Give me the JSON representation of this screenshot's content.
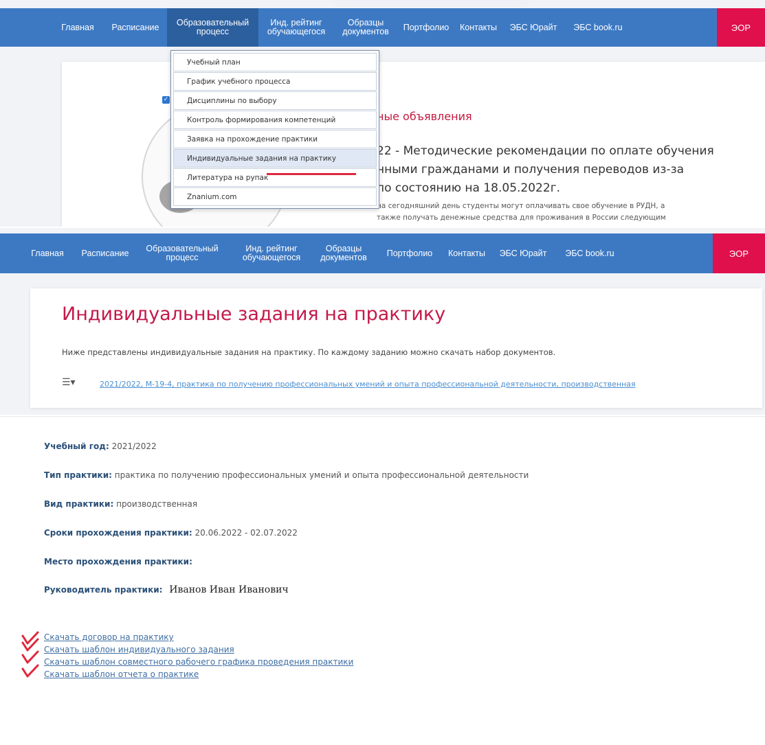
{
  "nav": {
    "items": [
      {
        "label": "Главная"
      },
      {
        "label": "Расписание"
      },
      {
        "label": "Образовательный\nпроцесс"
      },
      {
        "label": "Инд. рейтинг\nобучающегося"
      },
      {
        "label": "Образцы\nдокументов"
      },
      {
        "label": "Портфолио"
      },
      {
        "label": "Контакты"
      },
      {
        "label": "ЭБС Юрайт"
      },
      {
        "label": "ЭБС book.ru"
      }
    ],
    "zor_label": "ЭОР"
  },
  "dropdown": {
    "items": [
      {
        "label": "Учебный план"
      },
      {
        "label": "График учебного процесса"
      },
      {
        "label": "Дисциплины по выбору"
      },
      {
        "label": "Контроль формирования компетенций"
      },
      {
        "label": "Заявка на прохождение практики"
      },
      {
        "label": "Индивидуальные задания на практику"
      },
      {
        "label": "Литература на рупак"
      },
      {
        "label": "Znanium.com"
      }
    ]
  },
  "news": {
    "title": "ные объявления",
    "lines": [
      "22 - Методические рекомендации по оплате обучения",
      "нными гражданами и получения переводов из-за",
      "по состоянию на 18.05.2022г."
    ],
    "body_lines": [
      "на сегодняшний день студенты могут оплачивать свое обучение в РУДН, а",
      "также получать денежные средства для проживания в России следующим"
    ]
  },
  "page": {
    "title": "Индивидуальные задания на практику",
    "intro": "Ниже представлены индивидуальные задания на практику. По каждому заданию можно скачать набор документов.",
    "practice_link": "2021/2022, М-19-4, практика по получению профессиональных умений и опыта профессиональной деятельности, производственная"
  },
  "details": {
    "year_label": "Учебный год:",
    "year_value": "2021/2022",
    "type_label": "Тип практики:",
    "type_value": "практика по получению профессиональных умений и опыта профессиональной деятельности",
    "kind_label": "Вид практики:",
    "kind_value": "производственная",
    "dates_label": "Сроки прохождения практики:",
    "dates_value": "20.06.2022 - 02.07.2022",
    "place_label": "Место прохождения практики:",
    "supervisor_label": "Руководитель практики:",
    "supervisor_value": "Иванов Иван Иванович"
  },
  "downloads": [
    {
      "label": "Скачать договор на практику"
    },
    {
      "label": "Скачать шаблон индивидуального задания"
    },
    {
      "label": "Скачать шаблон совместного рабочего графика проведения практики"
    },
    {
      "label": "Скачать шаблон отчета о практике"
    }
  ],
  "colors": {
    "navbar": "#3d79c3",
    "zor": "#e0104c",
    "title": "#c41a4a",
    "annotation": "#e0273c"
  }
}
